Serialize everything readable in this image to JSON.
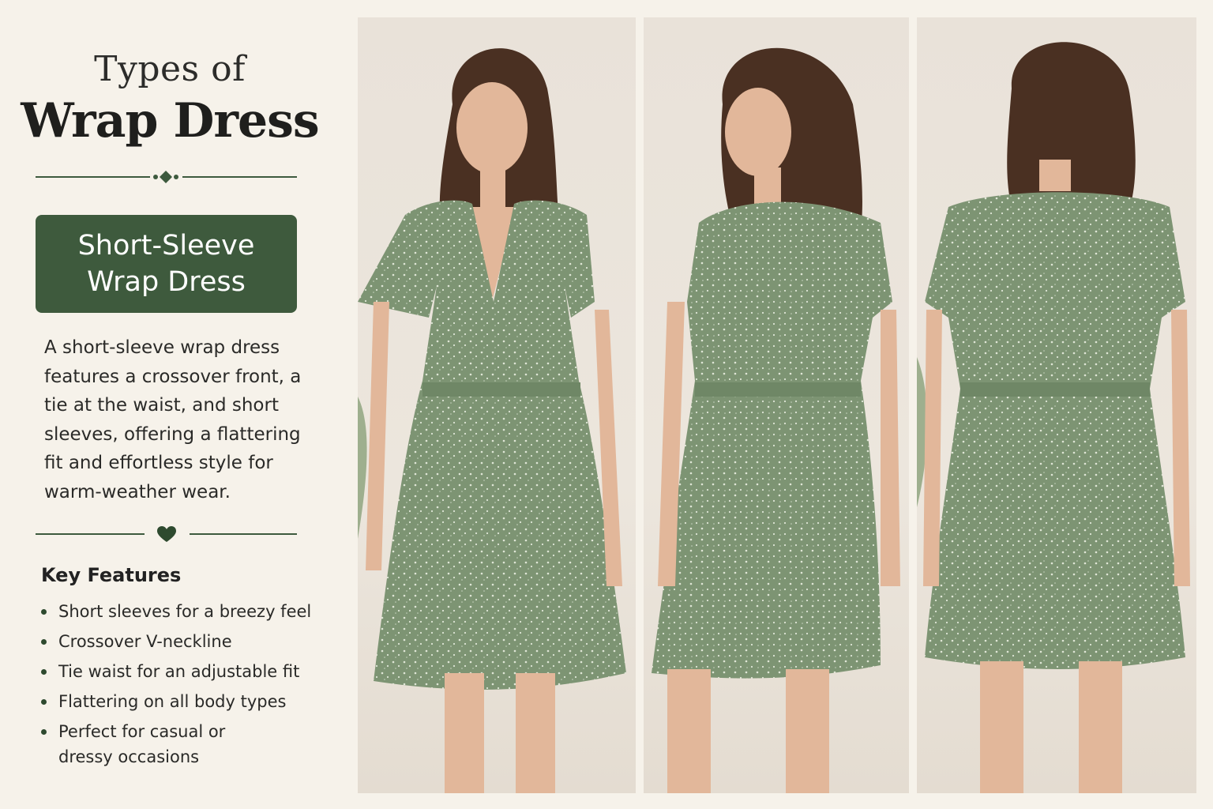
{
  "header": {
    "title_line1": "Types of",
    "title_line2": "Wrap Dress"
  },
  "badge": {
    "line1": "Short-Sleeve",
    "line2": "Wrap Dress"
  },
  "description": [
    "A short-sleeve wrap dress",
    "features a crossover front, a",
    "tie at the waist, and short",
    "sleeves, offering a flattering",
    "fit and effortless style for",
    "warm-weather wear."
  ],
  "features": {
    "title": "Key Features",
    "items": [
      [
        "Short sleeves for a breezy feel"
      ],
      [
        "Crossover V-neckline"
      ],
      [
        "Tie waist for an adjustable fit"
      ],
      [
        "Flattering on all body types"
      ],
      [
        "Perfect for casual or",
        "dressy occasions"
      ]
    ]
  },
  "photos": [
    {
      "view": "front-view",
      "icon": "model-front-photo"
    },
    {
      "view": "side-view",
      "icon": "model-side-photo"
    },
    {
      "view": "back-view",
      "icon": "model-back-photo"
    }
  ],
  "colors": {
    "accent": "#3e5a3d",
    "background": "#f6f2ea",
    "dress": "#7d9473",
    "hair": "#4a3022",
    "skin": "#e2b79a"
  },
  "icons": [
    "diamond-divider-icon",
    "heart-divider-icon"
  ]
}
